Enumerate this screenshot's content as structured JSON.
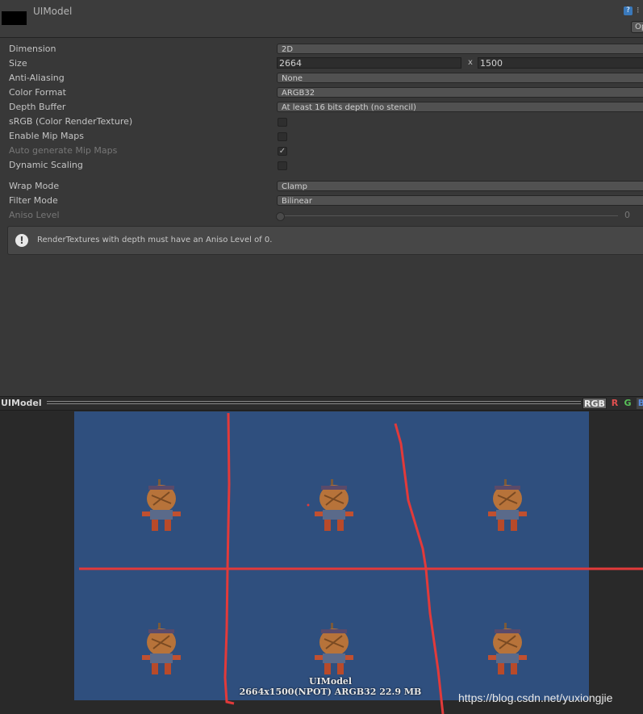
{
  "header": {
    "title": "UIModel",
    "open_label": "Op",
    "help_glyph": "?",
    "gear_glyph": "⁝"
  },
  "props": {
    "dimension": {
      "label": "Dimension",
      "value": "2D"
    },
    "size": {
      "label": "Size",
      "width": "2664",
      "separator": "x",
      "height": "1500"
    },
    "anti_aliasing": {
      "label": "Anti-Aliasing",
      "value": "None"
    },
    "color_format": {
      "label": "Color Format",
      "value": "ARGB32"
    },
    "depth_buffer": {
      "label": "Depth Buffer",
      "value": "At least 16 bits depth (no stencil)"
    },
    "srgb": {
      "label": "sRGB (Color RenderTexture)",
      "checked": false
    },
    "enable_mip": {
      "label": "Enable Mip Maps",
      "checked": false
    },
    "auto_mip": {
      "label": "Auto generate Mip Maps",
      "checked": true,
      "check_glyph": "✓"
    },
    "dynamic_scaling": {
      "label": "Dynamic Scaling",
      "checked": false
    },
    "wrap_mode": {
      "label": "Wrap Mode",
      "value": "Clamp"
    },
    "filter_mode": {
      "label": "Filter Mode",
      "value": "Bilinear"
    },
    "aniso_level": {
      "label": "Aniso Level",
      "value": "0"
    }
  },
  "help_box": {
    "icon_glyph": "!",
    "text": "RenderTextures with depth must have an Aniso Level of 0."
  },
  "preview": {
    "title": "UIModel",
    "channels": {
      "rgb": "RGB",
      "r": "R",
      "g": "G",
      "b": "B"
    },
    "caption_name": "UIModel",
    "caption_info": "2664x1500(NPOT)  ARGB32  22.9 MB",
    "background_color": "#2f4f7e",
    "annotation_color": "#e23a3a"
  },
  "watermark": "https://blog.csdn.net/yuxiongjie"
}
